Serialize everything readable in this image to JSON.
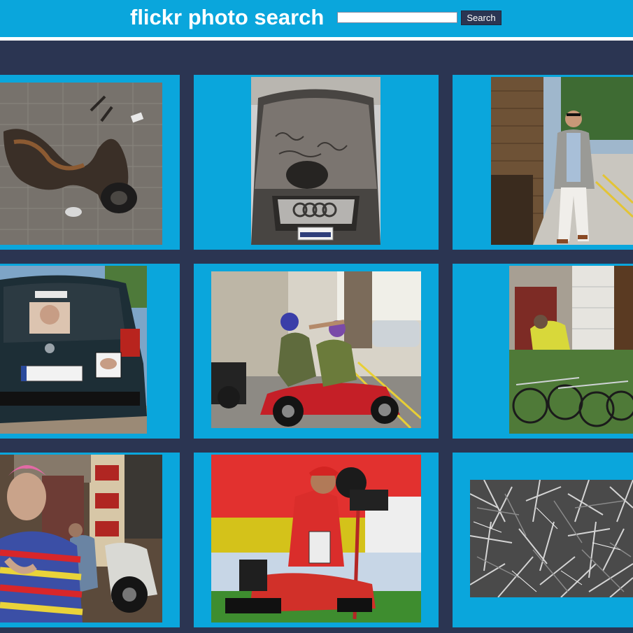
{
  "app": {
    "title": "flickr photo search"
  },
  "search": {
    "value": "",
    "placeholder": "",
    "button_label": "Search"
  },
  "colors": {
    "header": "#0aa6dc",
    "page_background": "#2b3552",
    "tile": "#0aa6dc",
    "button": "#2b3552"
  },
  "results": [
    {
      "subject": "burned scooter wreck on paving stones"
    },
    {
      "subject": "dusty audi car with writing on hood"
    },
    {
      "subject": "man in grey blazer walking on sidewalk"
    },
    {
      "subject": "rear of dark opel car with sticker"
    },
    {
      "subject": "two men on red motorbike in street"
    },
    {
      "subject": "parked bicycles by red door"
    },
    {
      "subject": "elderly man with pink hair at market"
    },
    {
      "subject": "photographer sitting with telephoto lens"
    },
    {
      "subject": "black and white dry twigs texture"
    }
  ]
}
